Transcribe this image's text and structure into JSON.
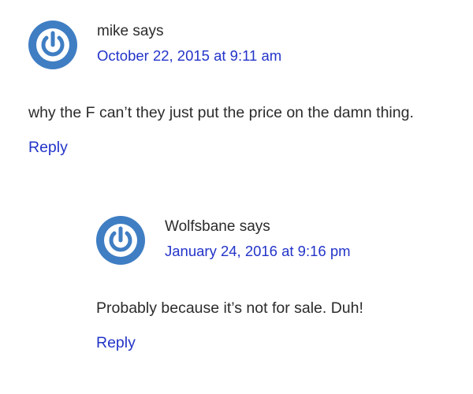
{
  "colors": {
    "link": "#2334c9",
    "text": "#2b2b2b",
    "avatar_blue": "#3f7ec3"
  },
  "comments": [
    {
      "author": "mike",
      "says": "says",
      "date": "October 22, 2015 at 9:11 am",
      "text": "why the F can’t they just put the price on the damn thing.",
      "reply_label": "Reply",
      "avatar_icon": "power-symbol-avatar-icon"
    },
    {
      "author": "Wolfsbane",
      "says": "says",
      "date": "January 24, 2016 at 9:16 pm",
      "text": "Probably because it’s not for sale. Duh!",
      "reply_label": "Reply",
      "avatar_icon": "power-symbol-avatar-icon"
    }
  ]
}
